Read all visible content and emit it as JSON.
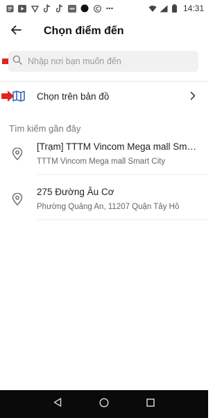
{
  "status_bar": {
    "time": "14:31",
    "left_icons": [
      "notes-icon",
      "play-icon",
      "vietnam-flag-icon",
      "tiktok-icon",
      "tiktok-icon",
      "app-icon",
      "dot-icon",
      "copyright-icon",
      "more-dots-icon"
    ],
    "right_icons": [
      "wifi-icon",
      "signal-icon",
      "battery-icon"
    ]
  },
  "header": {
    "title": "Chọn điểm đến",
    "back_icon": "arrow-left-icon"
  },
  "search": {
    "placeholder": "Nhập nơi bạn muốn đến",
    "icon": "search-icon"
  },
  "map_option": {
    "label": "Chọn trên bản đồ",
    "icon": "map-icon"
  },
  "recent": {
    "title": "Tìm kiếm gần đây",
    "items": [
      {
        "name": "[Trạm] TTTM Vincom Mega mall Smart City",
        "address": "TTTM Vincom Mega mall Smart City"
      },
      {
        "name": "275 Đường Âu Cơ",
        "address": "Phường Quảng An, 11207 Quận Tây Hồ"
      }
    ]
  },
  "colors": {
    "accent_marker": "#e02424",
    "map_icon": "#2f5fb0",
    "search_bg": "#f1f1f1",
    "nav_bar_bg": "#0a0a0a"
  }
}
